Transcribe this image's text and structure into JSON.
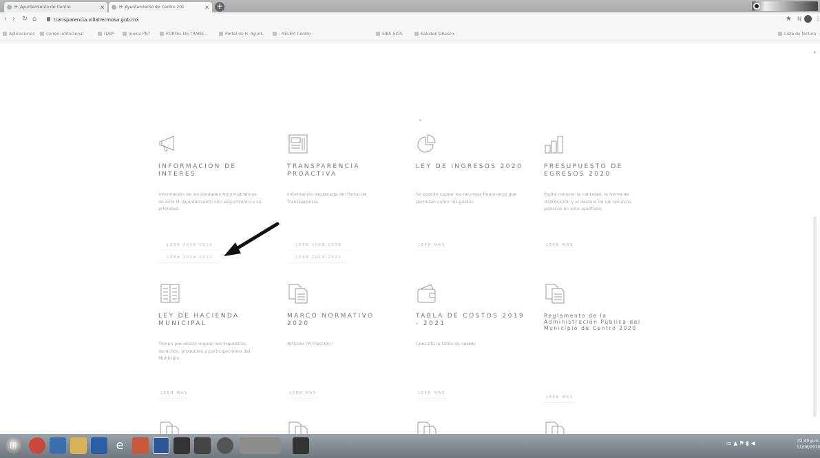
{
  "browser": {
    "tabs": [
      {
        "title": "H. Ayuntamiento de Centro"
      },
      {
        "title": "H. Ayuntamiento de Centro 201"
      }
    ],
    "new_tab_label": "+",
    "url": "transparencia.villahermosa.gob.mx",
    "bookmarks": [
      "Aplicaciones",
      "correo intitucional",
      "ITAIP",
      "Jouice PNT",
      "PORTAL DE TRANS...",
      "Portal de H. Ayunt..",
      "- RELEM Centro -",
      "SIBS-SIOS",
      "SaludenTabasco"
    ],
    "reading_list": "Lista de lectura"
  },
  "cards": [
    {
      "icon": "megaphone-icon",
      "title": "INFORMACIÓN DE INTERES",
      "description": "Información de las Unidades Administrativas de este H. Ayuntamiento con seguimiento a su prioridad.",
      "buttons": [
        "LEER 2018-2019",
        "LEER 2019-2021"
      ]
    },
    {
      "icon": "newspaper-icon",
      "title": "TRANSPARENCIA PROACTIVA",
      "description": "Información destacada del Portal de Transparencia.",
      "buttons": [
        "LEER 2018-2019",
        "LEER 2019-2021"
      ]
    },
    {
      "icon": "pie-chart-icon",
      "title": "LEY DE INGRESOS 2020",
      "description": "Se podrán captar los recursos financieros que permitan cubrir los gastos.",
      "buttons": [
        "LEER MAS"
      ]
    },
    {
      "icon": "bar-chart-icon",
      "title": "PRESUPUESTO DE EGRESOS 2020",
      "description": "Podrá conocer la cantidad, la forma de distribución y el destino de los recursos públicos en este apartado.",
      "buttons": [
        "LEER MAS"
      ]
    },
    {
      "icon": "document-lines-icon",
      "title": "LEY DE HACIENDA MUNICIPAL",
      "description": "Tienen por objeto regular los impuestos, derechos, productos y participaciones del Municipio.",
      "buttons": [
        "LEER MAS"
      ]
    },
    {
      "icon": "copy-icon",
      "title": "MARCO NORMATIVO 2020",
      "description": "Artículo 76 Fracción I",
      "buttons": [
        "LEER MAS"
      ]
    },
    {
      "icon": "wallet-icon",
      "title": "TABLA DE COSTOS 2019 - 2021",
      "description": "Consulta la tabla de costos",
      "buttons": [
        "LEER MAS"
      ]
    },
    {
      "icon": "copy-icon",
      "title": "Reglamento de la Administración Pública del Municipio de Centro 2020",
      "description": "",
      "buttons": [
        "LEER MAS"
      ]
    }
  ],
  "taskbar": {
    "start": "⊞",
    "apps": [
      "chrome",
      "media",
      "explorer",
      "outlook",
      "ie",
      "powerpoint",
      "word",
      "app7",
      "app8",
      "app9",
      "app10"
    ],
    "clock_time": "02:49 p.m.",
    "clock_date": "11/06/2020"
  }
}
